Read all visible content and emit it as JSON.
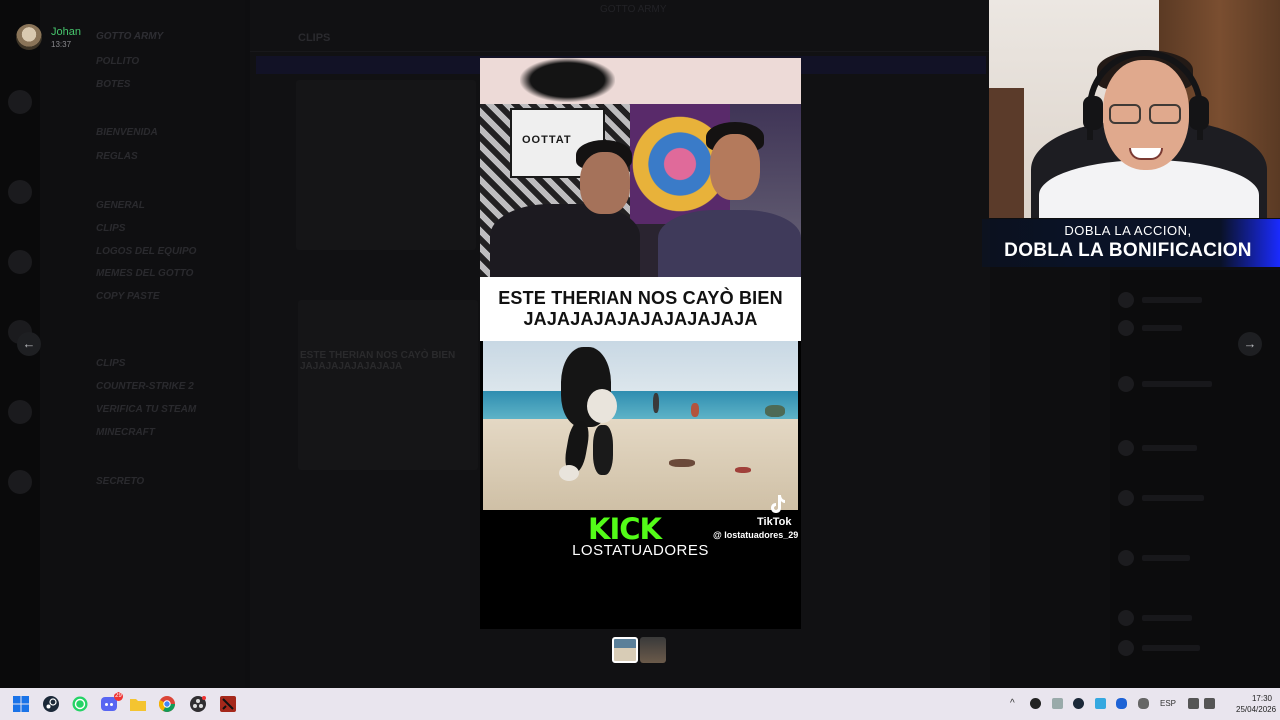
{
  "window": {
    "title": "GOTTO ARMY"
  },
  "user": {
    "name": "Johan",
    "time": "13:37"
  },
  "server": {
    "name": "GOTTO ARMY",
    "channels": [
      "POLLITO",
      "BOTES",
      "BIENVENIDA",
      "REGLAS",
      "GENERAL",
      "CLIPS",
      "LOGOS DEL EQUIPO",
      "MEMES DEL GOTTO",
      "COPY PASTE",
      "CLIPS",
      "COUNTER-STRIKE 2",
      "VERIFICA TU STEAM",
      "MINECRAFT",
      "SECRETO"
    ]
  },
  "chat": {
    "channel": "CLIPS"
  },
  "navigation": {
    "prev_icon": "←",
    "next_icon": "→"
  },
  "video": {
    "caption_line1": "ESTE THERIAN NOS CAYÒ BIEN",
    "caption_line2": "JAJAJAJAJAJAJAJAJAJA",
    "studio_sign": "OOTTAT",
    "tiktok_label": "TikTok",
    "tiktok_handle": "@ lostatuadores_29",
    "kick_logo": "KICK",
    "kick_channel": "LOSTATUADORES"
  },
  "ghost_caption": "ESTE THERIAN NOS CAYÒ BIEN JAJAJAJAJAJAJAJA",
  "overlay": {
    "line1": "DOBLA LA ACCION,",
    "line2": "DOBLA LA BONIFICACION"
  },
  "taskbar": {
    "language": "ESP",
    "time": "17:30",
    "date": "25/04/2026",
    "discord_badge": "29",
    "apps": [
      "windows-start",
      "steam",
      "whatsapp",
      "discord",
      "file-explorer",
      "chrome",
      "obs",
      "dota2"
    ]
  },
  "colors": {
    "kick_green": "#53fc18",
    "user_name": "#46c46c",
    "banner": "#0a1226"
  }
}
